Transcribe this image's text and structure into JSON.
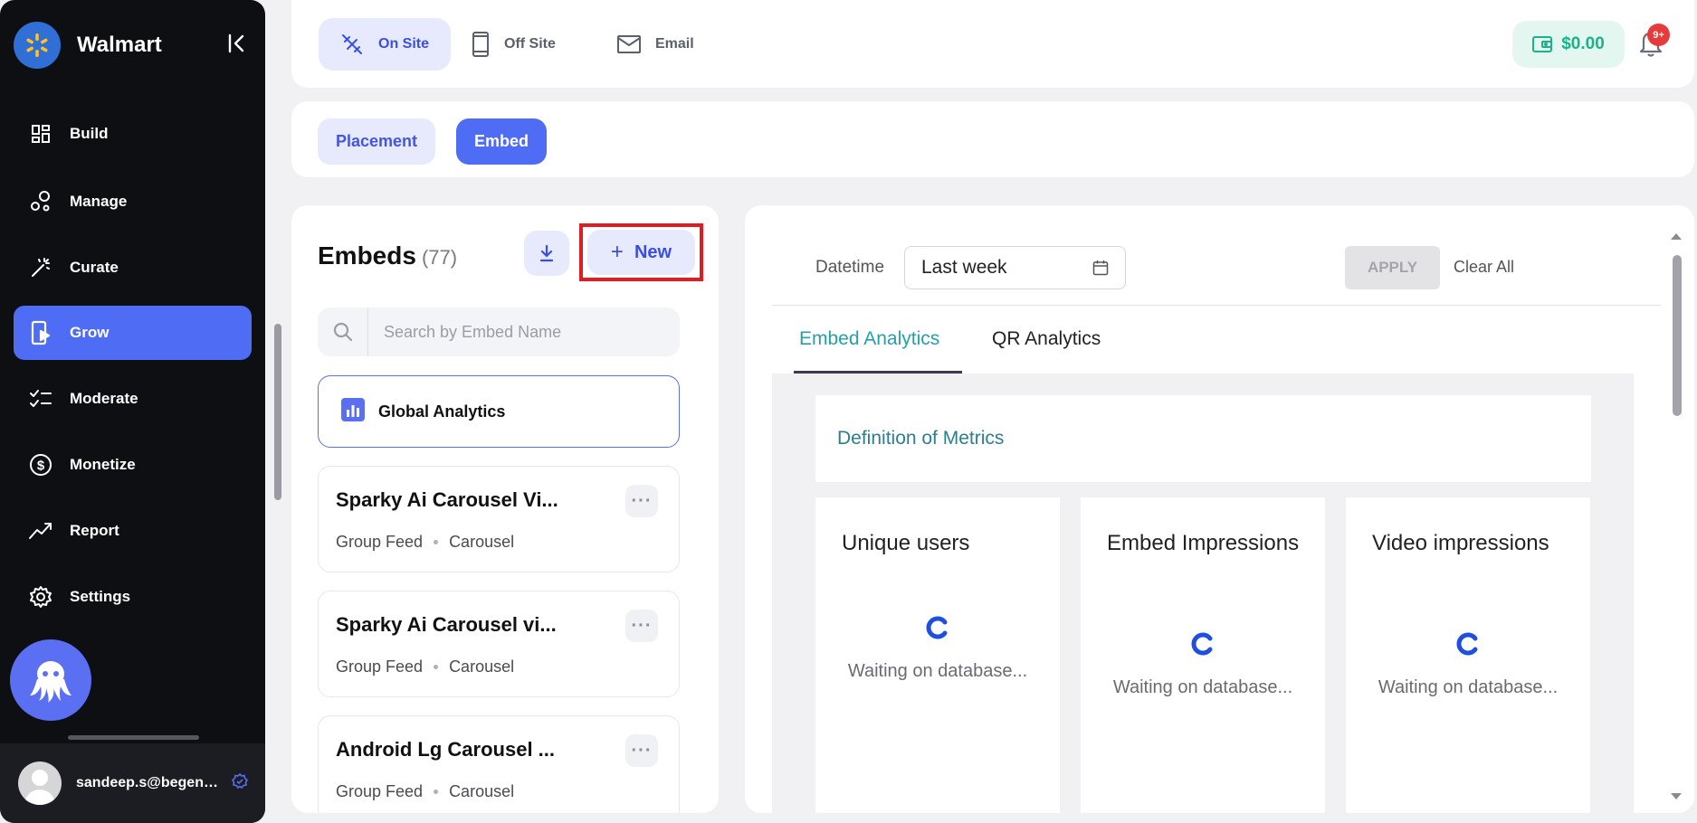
{
  "sidebar": {
    "brand": "Walmart",
    "items": [
      {
        "label": "Build",
        "icon": "grid-icon"
      },
      {
        "label": "Manage",
        "icon": "manage-icon"
      },
      {
        "label": "Curate",
        "icon": "magic-wand-icon"
      },
      {
        "label": "Grow",
        "icon": "grow-icon"
      },
      {
        "label": "Moderate",
        "icon": "checklist-icon"
      },
      {
        "label": "Monetize",
        "icon": "dollar-icon"
      },
      {
        "label": "Report",
        "icon": "trend-icon"
      },
      {
        "label": "Settings",
        "icon": "gear-icon"
      }
    ],
    "active_item": "Grow",
    "user_email": "sandeep.s@begenuin.com"
  },
  "topbar": {
    "channels": [
      {
        "label": "On Site",
        "active": true
      },
      {
        "label": "Off Site",
        "active": false
      },
      {
        "label": "Email",
        "active": false
      }
    ],
    "wallet": "$0.00",
    "notification_badge": "9+"
  },
  "subtabs": {
    "placement": "Placement",
    "embed": "Embed",
    "active": "Embed"
  },
  "embeds_panel": {
    "title": "Embeds",
    "count": "(77)",
    "new_label": "New",
    "search_placeholder": "Search by Embed Name",
    "global_analytics": "Global Analytics",
    "items": [
      {
        "title": "Sparky Ai Carousel Vi...",
        "type": "Group Feed",
        "format": "Carousel"
      },
      {
        "title": "Sparky Ai Carousel vi...",
        "type": "Group Feed",
        "format": "Carousel"
      },
      {
        "title": "Android Lg Carousel ...",
        "type": "Group Feed",
        "format": "Carousel"
      }
    ]
  },
  "analytics": {
    "datetime_label": "Datetime",
    "datetime_value": "Last week",
    "apply_label": "APPLY",
    "clear_label": "Clear All",
    "tabs": [
      "Embed Analytics",
      "QR Analytics"
    ],
    "active_tab": "Embed Analytics",
    "definition_link": "Definition of Metrics",
    "metrics": [
      {
        "title": "Unique users",
        "status": "Waiting on database..."
      },
      {
        "title": "Embed Impressions",
        "status": "Waiting on database..."
      },
      {
        "title": "Video impressions",
        "status": "Waiting on database..."
      }
    ]
  },
  "colors": {
    "sidebar_bg": "#0e0f13",
    "accent": "#4f6cf5",
    "teal": "#26a0a8",
    "wallet_green": "#1bb28a",
    "highlight_red": "#e01b24"
  }
}
